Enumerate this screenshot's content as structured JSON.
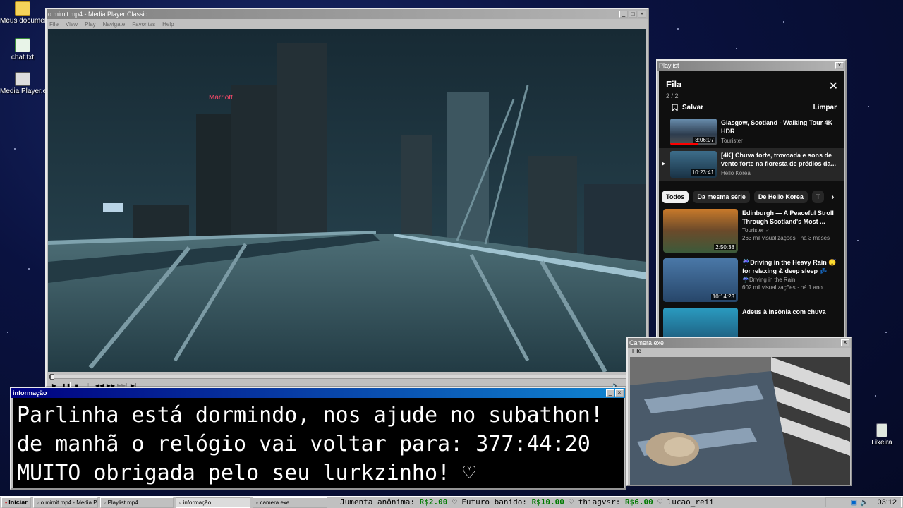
{
  "desktop": {
    "icons": [
      {
        "label": "Meus documentos"
      },
      {
        "label": "chat.txt"
      },
      {
        "label": "Media Player.exe"
      }
    ],
    "recycle_label": "Lixeira"
  },
  "media_player": {
    "title": "o mimit.mp4 - Media Player Classic",
    "menu": [
      "File",
      "View",
      "Play",
      "Navigate",
      "Favorites",
      "Help"
    ],
    "controls": [
      "▶",
      "❚❚",
      "■",
      "|◀◀",
      "◀◀",
      "▶▶",
      "▶▶|",
      "▶|"
    ],
    "volume_icon": "🔈",
    "sign_text": "Marriott"
  },
  "playlist_window": {
    "title": "Playlist",
    "heading": "Fila",
    "count": "2 / 2",
    "save_label": "Salvar",
    "clear_label": "Limpar",
    "queue": [
      {
        "title": "Glasgow, Scotland - Walking Tour 4K HDR",
        "channel": "Tourister",
        "duration": "3:06:07",
        "progress": 0.6
      },
      {
        "title": "[4K] Chuva forte, trovoada e sons de vento forte na floresta de prédios da...",
        "channel": "Hello Korea",
        "duration": "10:23:41",
        "playing": true
      }
    ],
    "chips": [
      "Todos",
      "Da mesma série",
      "De Hello Korea",
      "T"
    ],
    "recommendations": [
      {
        "title": "Edinburgh — A Peaceful Stroll Through Scotland's Most ...",
        "channel": "Tourister ✓",
        "meta": "263 mil visualizações · há 3 meses",
        "duration": "2:50:38"
      },
      {
        "title": "☔Driving in the Heavy Rain 😴 for relaxing & deep sleep 💤",
        "channel": "☔Driving in the Rain",
        "meta": "602 mil visualizações · há 1 ano",
        "duration": "10:14:23"
      },
      {
        "title": "Adeus à insônia com chuva",
        "channel": "",
        "meta": "",
        "duration": ""
      }
    ]
  },
  "info_window": {
    "title": "informação",
    "lines": [
      "Parlinha está dormindo, nos ajude no subathon!",
      "de manhã o relógio vai voltar para:  377:44:20",
      "MUITO obrigada pelo seu lurkzinho! ♡"
    ]
  },
  "camera_window": {
    "title": "Camera.exe",
    "menu": "File"
  },
  "taskbar": {
    "start_label": "Iniciar",
    "tasks": [
      {
        "label": "o mimit.mp4 - Media Playe..."
      },
      {
        "label": "Playlist.mp4"
      },
      {
        "label": "informação",
        "active": true
      },
      {
        "label": "camera.exe"
      }
    ],
    "ticker": [
      {
        "name": "Jumenta anônima:",
        "amount": "R$2.00"
      },
      {
        "name": "Futuro banido:",
        "amount": "R$10.00"
      },
      {
        "name": "thiagvsr:",
        "amount": "R$6.00"
      },
      {
        "name": "lucao_reii",
        "amount": ""
      }
    ],
    "clock": "03:12"
  }
}
